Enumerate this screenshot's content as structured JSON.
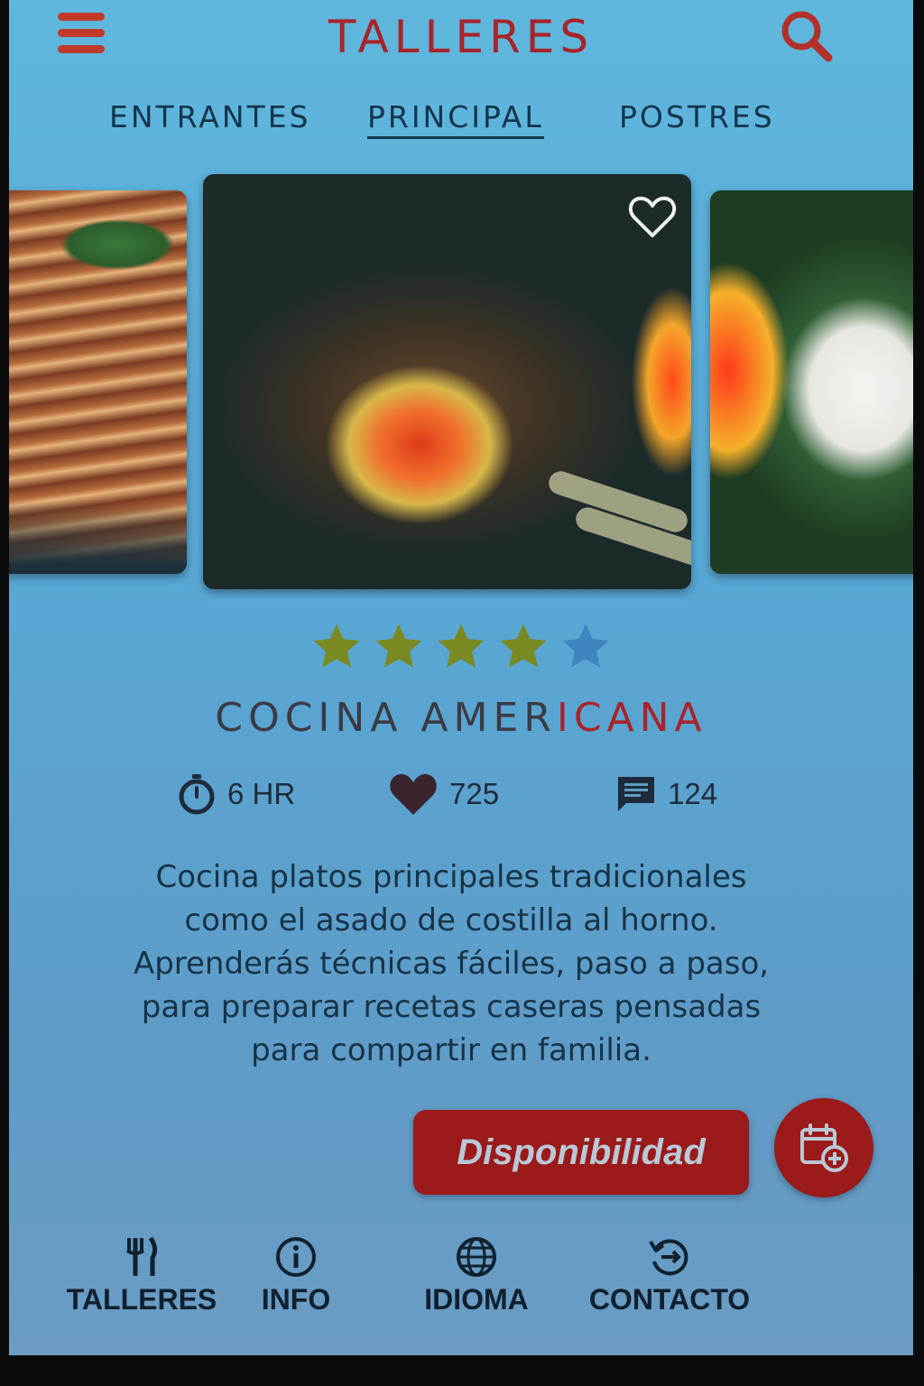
{
  "header": {
    "title": "TALLERES",
    "menu_icon": "hamburger-menu-icon",
    "search_icon": "search-icon"
  },
  "tabs": [
    {
      "label": "ENTRANTES",
      "active": false
    },
    {
      "label": "PRINCIPAL",
      "active": true
    },
    {
      "label": "POSTRES",
      "active": false
    }
  ],
  "carousel": {
    "favorite_icon": "heart-outline-icon"
  },
  "course": {
    "rating": 4,
    "rating_max": 5,
    "title_part1": "COCINA  AMER",
    "title_accent": "ICANA",
    "stats": {
      "duration": "6 HR",
      "likes": "725",
      "comments": "124"
    },
    "description": "Cocina platos principales tradicionales como el asado de costilla al horno. Aprenderás técnicas fáciles, paso a paso, para preparar recetas caseras pensadas para compartir en familia."
  },
  "actions": {
    "availability_label": "Disponibilidad",
    "add_to_calendar_icon": "calendar-add-icon"
  },
  "bottom_nav": [
    {
      "label": "TALLERES",
      "icon": "fork-knife-icon"
    },
    {
      "label": "INFO",
      "icon": "info-icon"
    },
    {
      "label": "IDIOMA",
      "icon": "globe-icon"
    },
    {
      "label": "CONTACTO",
      "icon": "contact-icon"
    }
  ],
  "colors": {
    "brand_red": "#a8242a",
    "button_red": "#9b1a1a",
    "star_filled": "#7a8a22",
    "star_empty": "#3f86c0"
  }
}
